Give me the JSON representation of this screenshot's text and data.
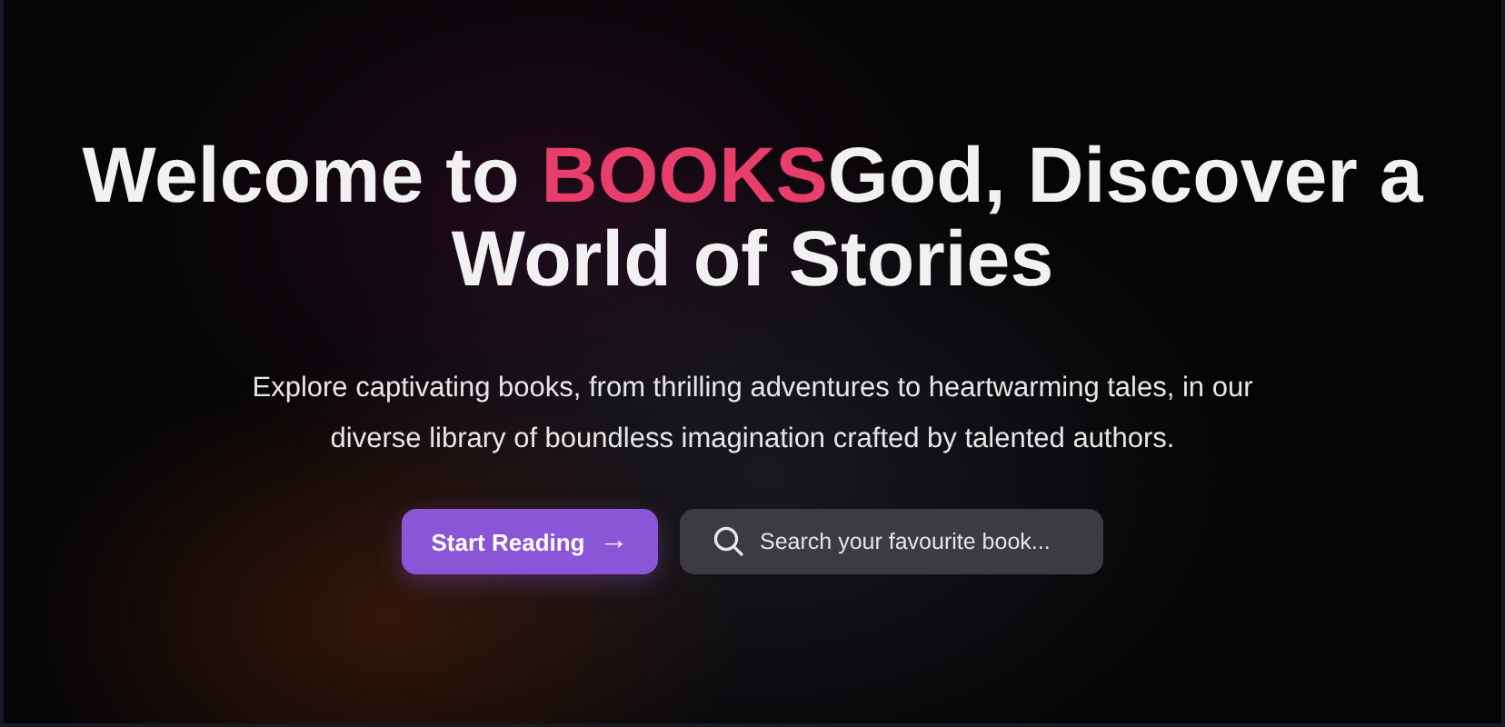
{
  "hero": {
    "title": {
      "before": "Welcome to ",
      "highlight": "BOOKS",
      "after": "God, Discover a World of Stories"
    },
    "subtitle": "Explore captivating books, from thrilling adventures to heartwarming tales, in our diverse library of boundless imagination crafted by talented authors.",
    "cta": {
      "label": "Start Reading",
      "icon": "→"
    },
    "search": {
      "placeholder": "Search your favourite book..."
    }
  }
}
